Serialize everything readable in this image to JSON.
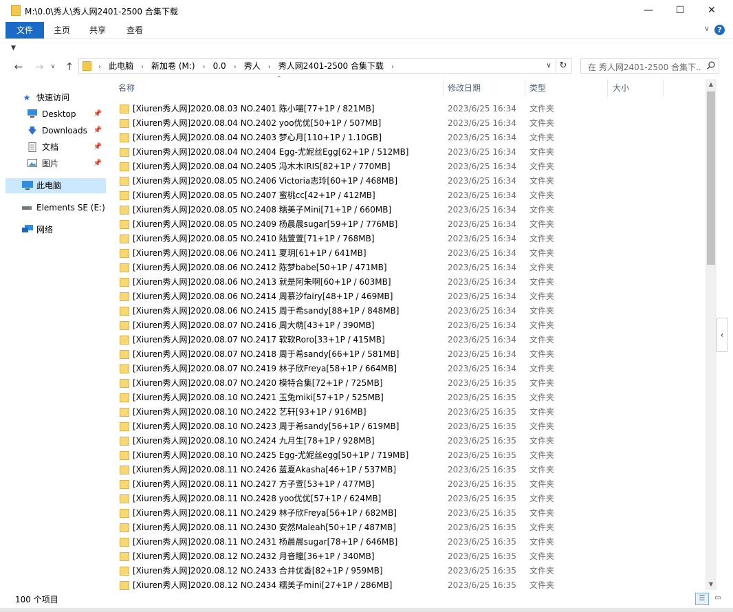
{
  "window": {
    "title": "M:\\0.0\\秀人\\秀人网2401-2500 合集下载",
    "minimize": "—",
    "maximize": "☐",
    "close": "✕"
  },
  "ribbon": {
    "tabs": [
      "文件",
      "主页",
      "共享",
      "查看"
    ],
    "active_tab": "文件",
    "help": "?"
  },
  "nav": {
    "back": "←",
    "forward": "→",
    "up": "↑",
    "breadcrumbs": [
      "此电脑",
      "新加卷 (M:)",
      "0.0",
      "秀人",
      "秀人网2401-2500 合集下载"
    ],
    "search_placeholder": "在 秀人网2401-2500 合集下..."
  },
  "sidebar": {
    "items": [
      {
        "label": "快速访问",
        "icon": "star-icon"
      },
      {
        "label": "Desktop",
        "icon": "desktop-icon",
        "pinned": true
      },
      {
        "label": "Downloads",
        "icon": "download-icon",
        "pinned": true
      },
      {
        "label": "文档",
        "icon": "document-icon",
        "pinned": true
      },
      {
        "label": "图片",
        "icon": "picture-icon",
        "pinned": true
      },
      {
        "label": "此电脑",
        "icon": "computer-icon",
        "selected": true
      },
      {
        "label": "Elements SE (E:)",
        "icon": "drive-icon"
      },
      {
        "label": "网络",
        "icon": "network-icon"
      }
    ]
  },
  "columns": {
    "name": "名称",
    "date": "修改日期",
    "type": "类型",
    "size": "大小"
  },
  "files": [
    {
      "name": "[Xiuren秀人网]2020.08.03 NO.2401 陈小喵[77+1P / 821MB]",
      "date": "2023/6/25 16:34",
      "type": "文件夹"
    },
    {
      "name": "[Xiuren秀人网]2020.08.04 NO.2402 yoo优优[50+1P / 507MB]",
      "date": "2023/6/25 16:34",
      "type": "文件夹"
    },
    {
      "name": "[Xiuren秀人网]2020.08.04 NO.2403 梦心月[110+1P / 1.10GB]",
      "date": "2023/6/25 16:34",
      "type": "文件夹"
    },
    {
      "name": "[Xiuren秀人网]2020.08.04 NO.2404 Egg-尤妮丝Egg[62+1P / 512MB]",
      "date": "2023/6/25 16:34",
      "type": "文件夹"
    },
    {
      "name": "[Xiuren秀人网]2020.08.04 NO.2405 冯木木IRIS[82+1P / 770MB]",
      "date": "2023/6/25 16:34",
      "type": "文件夹"
    },
    {
      "name": "[Xiuren秀人网]2020.08.05 NO.2406 Victoria志玲[60+1P / 468MB]",
      "date": "2023/6/25 16:34",
      "type": "文件夹"
    },
    {
      "name": "[Xiuren秀人网]2020.08.05 NO.2407 蜜桃cc[42+1P / 412MB]",
      "date": "2023/6/25 16:34",
      "type": "文件夹"
    },
    {
      "name": "[Xiuren秀人网]2020.08.05 NO.2408 糯美子Mini[71+1P / 660MB]",
      "date": "2023/6/25 16:34",
      "type": "文件夹"
    },
    {
      "name": "[Xiuren秀人网]2020.08.05 NO.2409 杨晨晨sugar[59+1P / 776MB]",
      "date": "2023/6/25 16:34",
      "type": "文件夹"
    },
    {
      "name": "[Xiuren秀人网]2020.08.05 NO.2410 陆萱萱[71+1P / 768MB]",
      "date": "2023/6/25 16:34",
      "type": "文件夹"
    },
    {
      "name": "[Xiuren秀人网]2020.08.06 NO.2411 夏玥[61+1P / 641MB]",
      "date": "2023/6/25 16:34",
      "type": "文件夹"
    },
    {
      "name": "[Xiuren秀人网]2020.08.06 NO.2412 陈梦babe[50+1P / 471MB]",
      "date": "2023/6/25 16:34",
      "type": "文件夹"
    },
    {
      "name": "[Xiuren秀人网]2020.08.06 NO.2413 就是阿朱啊[60+1P / 603MB]",
      "date": "2023/6/25 16:34",
      "type": "文件夹"
    },
    {
      "name": "[Xiuren秀人网]2020.08.06 NO.2414 周慕汐fairy[48+1P / 469MB]",
      "date": "2023/6/25 16:34",
      "type": "文件夹"
    },
    {
      "name": "[Xiuren秀人网]2020.08.06 NO.2415 周于希sandy[88+1P / 848MB]",
      "date": "2023/6/25 16:34",
      "type": "文件夹"
    },
    {
      "name": "[Xiuren秀人网]2020.08.07 NO.2416 周大萌[43+1P / 390MB]",
      "date": "2023/6/25 16:34",
      "type": "文件夹"
    },
    {
      "name": "[Xiuren秀人网]2020.08.07 NO.2417 软软Roro[33+1P / 415MB]",
      "date": "2023/6/25 16:34",
      "type": "文件夹"
    },
    {
      "name": "[Xiuren秀人网]2020.08.07 NO.2418 周于希sandy[66+1P / 581MB]",
      "date": "2023/6/25 16:34",
      "type": "文件夹"
    },
    {
      "name": "[Xiuren秀人网]2020.08.07 NO.2419 林子欣Freya[58+1P / 664MB]",
      "date": "2023/6/25 16:34",
      "type": "文件夹"
    },
    {
      "name": "[Xiuren秀人网]2020.08.07 NO.2420 模特合集[72+1P / 725MB]",
      "date": "2023/6/25 16:35",
      "type": "文件夹"
    },
    {
      "name": "[Xiuren秀人网]2020.08.10 NO.2421 玉兔miki[57+1P / 525MB]",
      "date": "2023/6/25 16:35",
      "type": "文件夹"
    },
    {
      "name": "[Xiuren秀人网]2020.08.10 NO.2422 艺轩[93+1P / 916MB]",
      "date": "2023/6/25 16:35",
      "type": "文件夹"
    },
    {
      "name": "[Xiuren秀人网]2020.08.10 NO.2423 周于希sandy[56+1P / 619MB]",
      "date": "2023/6/25 16:35",
      "type": "文件夹"
    },
    {
      "name": "[Xiuren秀人网]2020.08.10 NO.2424 九月生[78+1P / 928MB]",
      "date": "2023/6/25 16:35",
      "type": "文件夹"
    },
    {
      "name": "[Xiuren秀人网]2020.08.10 NO.2425 Egg-尤妮丝egg[50+1P / 719MB]",
      "date": "2023/6/25 16:35",
      "type": "文件夹"
    },
    {
      "name": "[Xiuren秀人网]2020.08.11 NO.2426 蓝夏Akasha[46+1P / 537MB]",
      "date": "2023/6/25 16:35",
      "type": "文件夹"
    },
    {
      "name": "[Xiuren秀人网]2020.08.11 NO.2427 方子萱[53+1P / 477MB]",
      "date": "2023/6/25 16:35",
      "type": "文件夹"
    },
    {
      "name": "[Xiuren秀人网]2020.08.11 NO.2428 yoo优优[57+1P / 624MB]",
      "date": "2023/6/25 16:35",
      "type": "文件夹"
    },
    {
      "name": "[Xiuren秀人网]2020.08.11 NO.2429 林子欣Freya[56+1P / 682MB]",
      "date": "2023/6/25 16:35",
      "type": "文件夹"
    },
    {
      "name": "[Xiuren秀人网]2020.08.11 NO.2430 安然Maleah[50+1P / 487MB]",
      "date": "2023/6/25 16:35",
      "type": "文件夹"
    },
    {
      "name": "[Xiuren秀人网]2020.08.11 NO.2431 杨晨晨sugar[78+1P / 646MB]",
      "date": "2023/6/25 16:35",
      "type": "文件夹"
    },
    {
      "name": "[Xiuren秀人网]2020.08.12 NO.2432 月音瞳[36+1P / 340MB]",
      "date": "2023/6/25 16:35",
      "type": "文件夹"
    },
    {
      "name": "[Xiuren秀人网]2020.08.12 NO.2433 合井优香[82+1P / 959MB]",
      "date": "2023/6/25 16:35",
      "type": "文件夹"
    },
    {
      "name": "[Xiuren秀人网]2020.08.12 NO.2434 糯美子mini[27+1P / 286MB]",
      "date": "2023/6/25 16:35",
      "type": "文件夹"
    }
  ],
  "status": {
    "item_count": "100 个项目"
  },
  "colors": {
    "accent": "#1a6bc8",
    "selected_bg": "#cce8ff",
    "folder": "#f8d775",
    "header_text": "#4c607a"
  }
}
